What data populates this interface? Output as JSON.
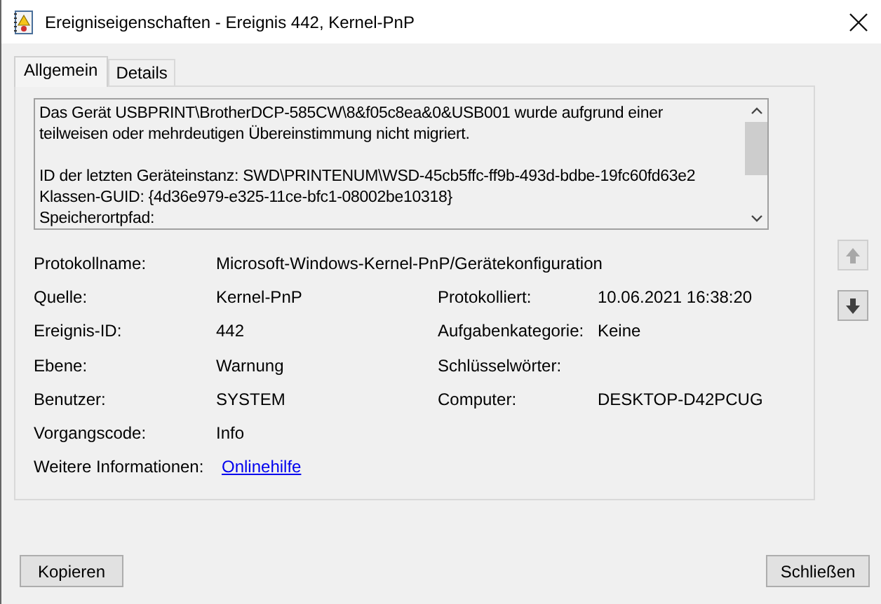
{
  "window": {
    "title": "Ereigniseigenschaften - Ereignis 442, Kernel-PnP"
  },
  "tabs": [
    {
      "label": "Allgemein",
      "selected": true
    },
    {
      "label": "Details",
      "selected": false
    }
  ],
  "message": {
    "lines": [
      {
        "text": "Das Gerät USBPRINT\\BrotherDCP-585CW\\8&f05c8ea&0&USB001 wurde aufgrund einer",
        "space_before": false
      },
      {
        "text": "teilweisen oder mehrdeutigen Übereinstimmung nicht migriert.",
        "space_before": false
      },
      {
        "text": "ID der letzten Geräteinstanz: SWD\\PRINTENUM\\WSD-45cb5ffc-ff9b-493d-bdbe-19fc60fd63e2",
        "space_before": true
      },
      {
        "text": "Klassen-GUID: {4d36e979-e325-11ce-bfc1-08002be10318}",
        "space_before": false
      },
      {
        "text": "Speicherortpfad:",
        "space_before": false
      }
    ]
  },
  "fields": [
    {
      "label": "Protokollname:",
      "value": "Microsoft-Windows-Kernel-PnP/Gerätekonfiguration",
      "kind": "wide"
    },
    {
      "label": "Quelle:",
      "value": "Kernel-PnP",
      "label_2": "Protokolliert:",
      "value_2": "10.06.2021 16:38:20",
      "kind": "pair"
    },
    {
      "label": "Ereignis-ID:",
      "value": "442",
      "label_2": "Aufgabenkategorie:",
      "value_2": "Keine",
      "kind": "pair"
    },
    {
      "label": "Ebene:",
      "value": "Warnung",
      "label_2": "Schlüsselwörter:",
      "kind": "pair"
    },
    {
      "label": "Benutzer:",
      "value": "SYSTEM",
      "label_2": "Computer:",
      "value_2": "DESKTOP-D42PCUG",
      "kind": "pair"
    },
    {
      "label": "Vorgangscode:",
      "value": "Info",
      "kind": "wide"
    },
    {
      "label": "Weitere Informationen:",
      "value": "Onlinehilfe",
      "kind": "link"
    }
  ],
  "nav": {
    "up_disabled": true,
    "down_disabled": false
  },
  "buttons": [
    {
      "label": "Kopieren"
    },
    {
      "label": "Schließen"
    }
  ]
}
